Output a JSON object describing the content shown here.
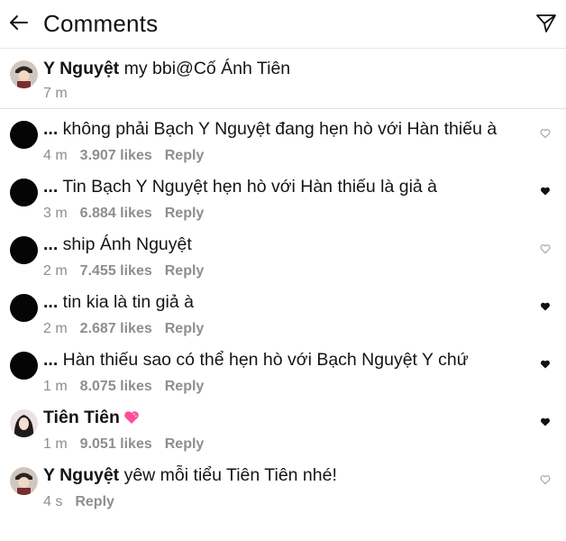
{
  "header": {
    "title": "Comments",
    "back_icon": "arrow-left-icon",
    "send_icon": "paper-plane-icon"
  },
  "caption": {
    "username": "Y Nguyệt",
    "text": " my bbi@Cố Ánh Tiên",
    "time": "7 m"
  },
  "comments": [
    {
      "username": "...",
      "text": " không phải Bạch Y Nguyệt đang hẹn hò với Hàn thiếu à",
      "time": "4 m",
      "likes": "3.907 likes",
      "reply": "Reply",
      "liked": false
    },
    {
      "username": "...",
      "text": " Tin Bạch Y Nguyệt hẹn hò với Hàn thiếu là giả à",
      "time": "3 m",
      "likes": "6.884 likes",
      "reply": "Reply",
      "liked": true
    },
    {
      "username": "...",
      "text": " ship Ánh Nguyệt",
      "time": "2 m",
      "likes": "7.455 likes",
      "reply": "Reply",
      "liked": false
    },
    {
      "username": "...",
      "text": " tin kia là tin giả à",
      "time": "2 m",
      "likes": "2.687 likes",
      "reply": "Reply",
      "liked": true
    },
    {
      "username": "...",
      "text": " Hàn thiếu sao có thể hẹn hò với Bạch Nguyệt Y chứ",
      "time": "1 m",
      "likes": "8.075 likes",
      "reply": "Reply",
      "liked": true
    },
    {
      "username": "Tiên Tiên",
      "text": "",
      "time": "1 m",
      "likes": "9.051 likes",
      "reply": "Reply",
      "liked": true,
      "emoji": "pink-heart-emoji"
    },
    {
      "username": "Y Nguyệt",
      "text": " yêw mỗi tiểu Tiên Tiên nhé!",
      "time": "4 s",
      "reply": "Reply",
      "liked": false
    }
  ],
  "colors": {
    "text": "#151515",
    "meta": "#8e8e8e",
    "divider": "#e0e0e0",
    "emoji_heart": "#ff4f9a"
  }
}
